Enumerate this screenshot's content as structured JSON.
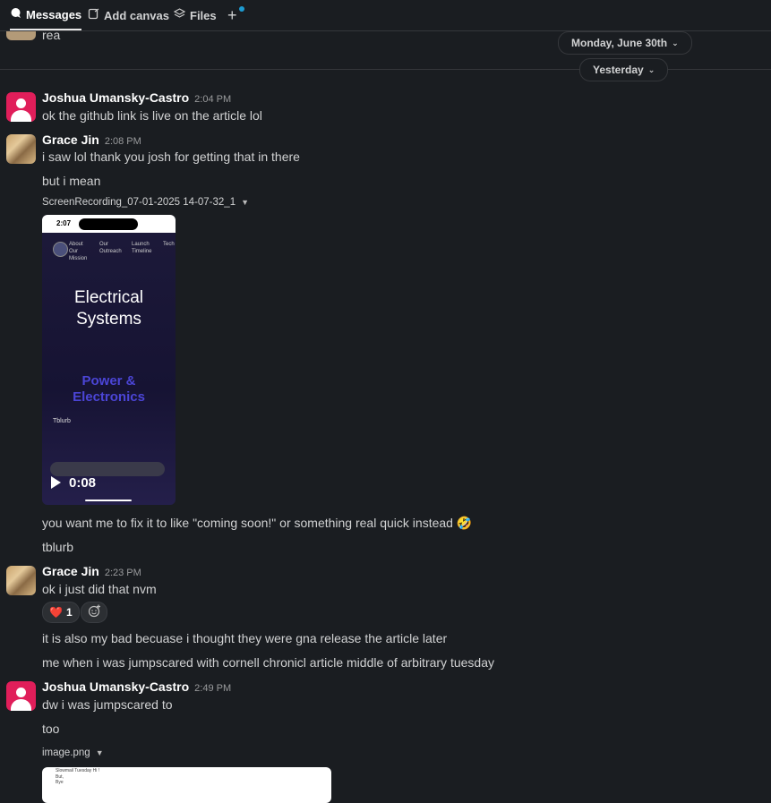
{
  "tabs": {
    "messages": "Messages",
    "add_canvas": "Add canvas",
    "files": "Files",
    "add": "+"
  },
  "dates": {
    "first": "Monday, June 30th",
    "second": "Yesterday",
    "caret": "⌄"
  },
  "truncated_message": "rea",
  "messages": [
    {
      "author": "Joshua Umansky-Castro",
      "time": "2:04 PM",
      "lines": [
        "ok the github link is live on the article lol"
      ]
    },
    {
      "author": "Grace Jin",
      "time": "2:08 PM",
      "lines": [
        "i saw lol thank you josh for getting that in there",
        "but i mean"
      ],
      "attachment": {
        "filename": "ScreenRecording_07-01-2025 14-07-32_1",
        "duration": "0:08",
        "preview": {
          "status_time": "2:07",
          "nav": [
            "About Our Mission",
            "Our Outreach",
            "Launch Timeline",
            "Tech"
          ],
          "title_line1": "Electrical",
          "title_line2": "Systems",
          "subtitle_line1": "Power &",
          "subtitle_line2": "Electronics",
          "tiny_text": "Tblurb"
        }
      },
      "after_lines": [
        "you want me to fix it to like \"coming soon!\" or something real quick instead 🤣",
        "tblurb"
      ]
    },
    {
      "author": "Grace Jin",
      "time": "2:23 PM",
      "lines": [
        "ok i just did that nvm"
      ],
      "reaction": {
        "emoji": "❤️",
        "count": "1"
      },
      "after_lines": [
        "it is also my bad becuase i thought they were gna release the article later",
        "me when i was jumpscared with cornell chronicl article middle of arbitrary tuesday"
      ]
    },
    {
      "author": "Joshua Umansky-Castro",
      "time": "2:49 PM",
      "lines": [
        "dw i was jumpscared to",
        "too"
      ],
      "attachment": {
        "filename": "image.png",
        "preview_lines": [
          "Slowmail Tuesday Hi !",
          "But,",
          "Bye"
        ]
      }
    }
  ],
  "colors": {
    "background": "#1a1d21",
    "avatar_pink": "#e01e5a",
    "notification_dot": "#1d9bd1"
  }
}
